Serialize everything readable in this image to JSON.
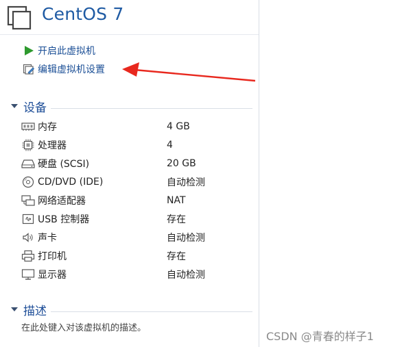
{
  "vm": {
    "title": "CentOS 7"
  },
  "actions": [
    {
      "label": "开启此虚拟机",
      "icon": "play-icon"
    },
    {
      "label": "编辑虚拟机设置",
      "icon": "edit-settings-icon"
    }
  ],
  "devices_section": {
    "title": "设备",
    "items": [
      {
        "name": "内存",
        "value": "4 GB",
        "icon": "memory-icon"
      },
      {
        "name": "处理器",
        "value": "4",
        "icon": "processor-icon"
      },
      {
        "name": "硬盘 (SCSI)",
        "value": "20 GB",
        "icon": "hard-disk-icon"
      },
      {
        "name": "CD/DVD (IDE)",
        "value": "自动检测",
        "icon": "cd-dvd-icon"
      },
      {
        "name": "网络适配器",
        "value": "NAT",
        "icon": "network-adapter-icon"
      },
      {
        "name": "USB 控制器",
        "value": "存在",
        "icon": "usb-icon"
      },
      {
        "name": "声卡",
        "value": "自动检测",
        "icon": "sound-card-icon"
      },
      {
        "name": "打印机",
        "value": "存在",
        "icon": "printer-icon"
      },
      {
        "name": "显示器",
        "value": "自动检测",
        "icon": "display-icon"
      }
    ]
  },
  "description_section": {
    "title": "描述",
    "placeholder": "在此处键入对该虚拟机的描述。"
  },
  "watermark": "CSDN @青春的样子1",
  "colors": {
    "title": "#1e5aa3",
    "link": "#1b4f96",
    "play_green": "#2e9a2e",
    "annotation_arrow": "#e8281e"
  }
}
